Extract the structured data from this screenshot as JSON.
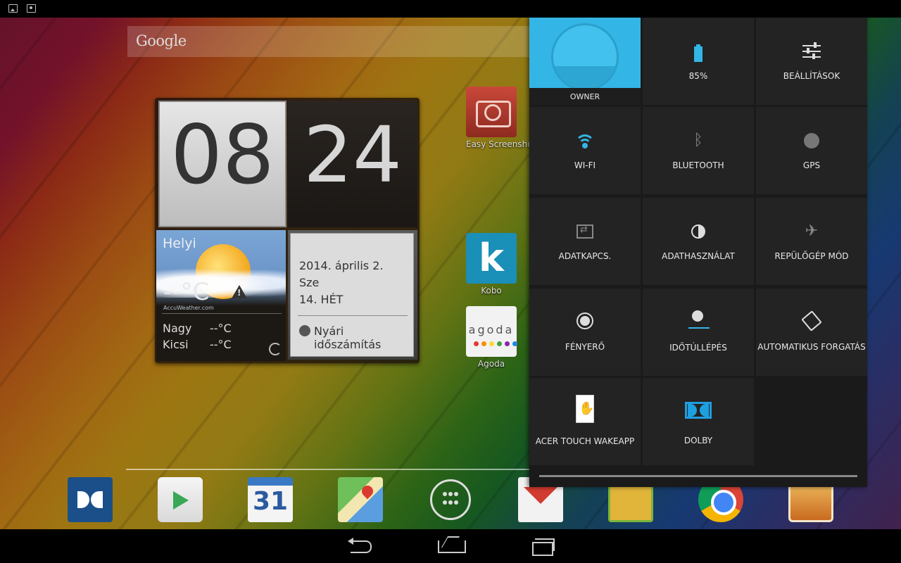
{
  "search": {
    "logo_text": "Google"
  },
  "clock": {
    "hour": "08",
    "minute": "24"
  },
  "weather": {
    "location": "Helyi",
    "temperature": "--°C",
    "provider": "AccuWeather.com",
    "high_label": "Nagy",
    "high_value": "--°C",
    "low_label": "Kicsi",
    "low_value": "--°C"
  },
  "date": {
    "full_date": "2014. április 2.",
    "weekday": "Sze",
    "week": "14. HÉT",
    "dst_label": "Nyári időszámítás"
  },
  "shortcuts": {
    "easy_screenshot": "Easy Screensho",
    "kobo": "Kobo",
    "kobo_letter": "k",
    "agoda": "Agoda",
    "agoda_logo": "agoda"
  },
  "dock": {
    "calendar_day": "31",
    "items": [
      "dolby-icon",
      "play-store-icon",
      "calendar-icon",
      "maps-icon",
      "all-apps-icon",
      "gmail-icon",
      "game-icon",
      "chrome-icon",
      "gallery-icon"
    ]
  },
  "quick_settings": {
    "owner": "OWNER",
    "battery": "85%",
    "settings": "BEÁLLÍTÁSOK",
    "wifi": "WI-FI",
    "bluetooth": "BLUETOOTH",
    "gps": "GPS",
    "data_connection": "ADATKAPCS.",
    "data_usage": "ADATHASZNÁLAT",
    "airplane_mode": "REPÜLŐGÉP MÓD",
    "brightness": "FÉNYERŐ",
    "timeout": "IDŐTÚLLÉPÉS",
    "auto_rotate": "AUTOMATIKUS FORGATÁS",
    "acer_touch": "ACER TOUCH WAKEAPP",
    "dolby": "DOLBY"
  },
  "colors": {
    "accent": "#33b5e5",
    "panel_bg": "#1a1a1a",
    "tile_bg": "#232323"
  }
}
